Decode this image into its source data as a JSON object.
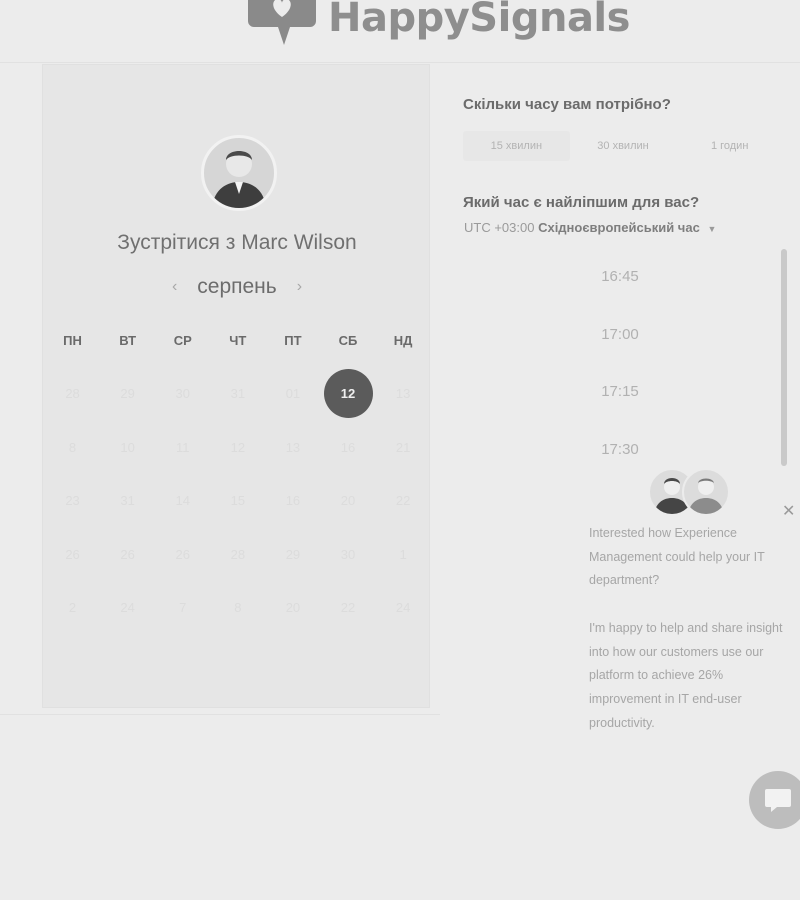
{
  "brand": {
    "name": "HappySignals"
  },
  "calendar": {
    "title": "Зустрітися з Marc Wilson",
    "month": "серпень",
    "weekdays": [
      "ПН",
      "ВТ",
      "СР",
      "ЧТ",
      "ПТ",
      "СБ",
      "НД"
    ],
    "days": [
      [
        "28",
        "29",
        "30",
        "31",
        "01",
        "12",
        "13"
      ],
      [
        "8",
        "10",
        "11",
        "12",
        "13",
        "16",
        "21"
      ],
      [
        "23",
        "31",
        "14",
        "15",
        "16",
        "20",
        "22"
      ],
      [
        "26",
        "26",
        "26",
        "28",
        "29",
        "30",
        "1"
      ],
      [
        "2",
        "24",
        "7",
        "8",
        "20",
        "22",
        "24"
      ]
    ],
    "selected_day": "12"
  },
  "scheduler": {
    "duration_question": "Скільки часу вам потрібно?",
    "durations": [
      "15 хвилин",
      "30 хвилин",
      "1 годин"
    ],
    "time_question": "Який час є найліпшим для вас?",
    "timezone_offset": "UTC +03:00",
    "timezone_name": "Східноєвропейський час",
    "time_slots": [
      "16:45",
      "17:00",
      "17:15",
      "17:30"
    ]
  },
  "chat": {
    "message_1": "Interested how Experience Management could help your IT department?",
    "message_2": "I'm happy to help and share insight into how our customers use our platform to achieve 26% improvement in IT end-user productivity."
  },
  "icons": {
    "logo": "speech-bubble-heart-icon",
    "prev": "chevron-left-icon",
    "next": "chevron-right-icon",
    "caret": "caret-down-icon",
    "close": "close-icon",
    "launcher": "chat-bubble-icon"
  }
}
